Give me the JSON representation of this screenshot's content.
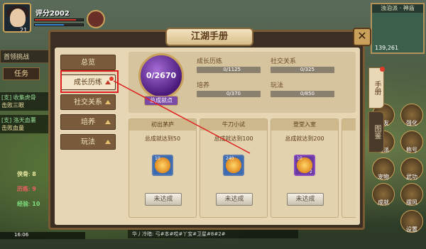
{
  "hud": {
    "score": "评分2002",
    "level": "21",
    "left_buttons": [
      "首领挑战",
      "任务"
    ],
    "quests": [
      {
        "tag": "[支] 收集虎骨",
        "desc": "击败三眼"
      },
      {
        "tag": "[支] 洛天血薯",
        "desc": "击败血童"
      }
    ],
    "stats": [
      {
        "label": "侠骨",
        "value": "8"
      },
      {
        "label": "历练",
        "value": "9"
      },
      {
        "label": "经验",
        "value": "10"
      }
    ],
    "time": "16:06"
  },
  "minimap": {
    "title": "浊泊派 · 神庙",
    "coord": "139,261"
  },
  "right_icons": [
    "好友",
    "强化",
    "门派",
    "称号",
    "宠物",
    "武功",
    "成就",
    "摆风",
    "设置"
  ],
  "modal": {
    "title": "江湖手册",
    "close_label": "✕",
    "side_tabs": [
      "手册",
      "图鉴"
    ],
    "nav": [
      {
        "label": "总览",
        "active": false
      },
      {
        "label": "成长历练",
        "active": true
      },
      {
        "label": "社交关系",
        "active": false
      },
      {
        "label": "培养",
        "active": false
      },
      {
        "label": "玩法",
        "active": false
      }
    ],
    "orb": {
      "value": "0/2670",
      "label": "总成就点"
    },
    "progress": [
      {
        "label": "成长历练",
        "value": "0/1125"
      },
      {
        "label": "社交关系",
        "value": "0/325"
      },
      {
        "label": "培养",
        "value": "0/370"
      },
      {
        "label": "玩法",
        "value": "0/850"
      }
    ],
    "cards": [
      {
        "name": "初出茅庐",
        "desc": "总成就达到50",
        "qty": "10",
        "button": "未达成"
      },
      {
        "name": "牛刀小试",
        "desc": "总成就达到100",
        "qty": "240",
        "button": "未达成"
      },
      {
        "name": "登堂入室",
        "desc": "总成就达到200",
        "qty": "10",
        "qty2": "2",
        "button": "未达成"
      },
      {
        "name": "出",
        "desc": "总成",
        "qty": "",
        "button": ""
      }
    ]
  },
  "chat": "华丿冷暗: 弓#本#哎#丫宝#卫星#8#2#"
}
